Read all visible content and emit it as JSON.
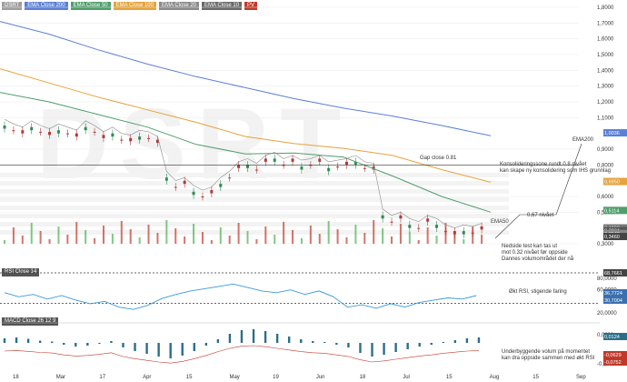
{
  "legend": [
    {
      "label": "DSRT",
      "color": "#9e9e9e"
    },
    {
      "label": "EMA Close 200",
      "color": "#5b7fd6"
    },
    {
      "label": "EMA Close 50",
      "color": "#4f9e6a"
    },
    {
      "label": "EMA Close 100",
      "color": "#e6a23c"
    },
    {
      "label": "EMA Close 20",
      "color": "#8a8a8a"
    },
    {
      "label": "EMA Close 10",
      "color": "#6a6a6a"
    },
    {
      "label": "PV",
      "color": "#c0392b"
    }
  ],
  "watermark": "DSRT",
  "rsi_label": "RSI Close 14",
  "macd_label": "MACD Close 26 12 9",
  "chart_data": [
    {
      "type": "candlestick",
      "ylim": [
        0.3,
        1.8
      ],
      "yticks": [
        "1,8000",
        "1,7000",
        "1,6000",
        "1,5000",
        "1,4000",
        "1,3000",
        "1,2000",
        "1,1000",
        "0,9000",
        "0,8000",
        "0,6000",
        "0,5000",
        "0,3000"
      ],
      "yticks_values": [
        1.8,
        1.7,
        1.6,
        1.5,
        1.4,
        1.3,
        1.2,
        1.1,
        0.9,
        0.8,
        0.6,
        0.5,
        0.3
      ],
      "x_ticks": [
        "18",
        "Mar",
        "17",
        "Apr",
        "15",
        "May",
        "19",
        "Jun",
        "18",
        "Jul",
        "15",
        "Aug",
        "15",
        "Sep"
      ],
      "price_badges": [
        {
          "label": "1,0036",
          "value": 1.0036,
          "color": "#5b7fd6"
        },
        {
          "label": "0,6950",
          "value": 0.695,
          "color": "#e6a23c"
        },
        {
          "label": "0,5114",
          "value": 0.5114,
          "color": "#4f9e6a"
        },
        {
          "label": "0,4008",
          "value": 0.4008,
          "color": "#777777"
        },
        {
          "label": "0,3834",
          "value": 0.3834,
          "color": "#555555"
        },
        {
          "label": "0,3648",
          "value": 0.3648,
          "color": "#888888"
        },
        {
          "label": "0,3460",
          "value": 0.346,
          "color": "#444444"
        }
      ],
      "annotations": [
        {
          "text": "Gap close 0.81",
          "target": "gap-close"
        },
        {
          "text": "Konsolideringssone rundt 0.8 nivået",
          "target": "consolidation"
        },
        {
          "text": "kan skape ny konsolidering som IHS grunnlag",
          "target": "consolidation"
        },
        {
          "text": "EMA200",
          "target": "ema200"
        },
        {
          "text": "0,67 nivået",
          "target": "level-067"
        },
        {
          "text": "EMA50",
          "target": "ema50"
        },
        {
          "text": "Nedside test kan tas ut",
          "target": "downside"
        },
        {
          "text": "mot 0.32 nivået før oppside",
          "target": "downside"
        },
        {
          "text": "Dannes volumområdet der nå",
          "target": "downside"
        }
      ],
      "series": [
        {
          "name": "EMA Close 200",
          "color": "#5b7fd6",
          "x": [
            0,
            0.1,
            0.2,
            0.3,
            0.4,
            0.5,
            0.6,
            0.7,
            0.8,
            0.9,
            1.0
          ],
          "values": [
            1.71,
            1.63,
            1.53,
            1.44,
            1.36,
            1.29,
            1.22,
            1.16,
            1.11,
            1.05,
            0.985
          ]
        },
        {
          "name": "EMA Close 100",
          "color": "#e6a23c",
          "x": [
            0,
            0.1,
            0.2,
            0.3,
            0.4,
            0.5,
            0.6,
            0.7,
            0.8,
            0.9,
            1.0
          ],
          "values": [
            1.41,
            1.32,
            1.23,
            1.15,
            1.07,
            0.98,
            0.935,
            0.905,
            0.86,
            0.77,
            0.69
          ]
        },
        {
          "name": "EMA Close 50",
          "color": "#4f9e6a",
          "x": [
            0,
            0.1,
            0.2,
            0.3,
            0.4,
            0.5,
            0.6,
            0.7,
            0.8,
            0.9,
            1.0
          ],
          "values": [
            1.26,
            1.2,
            1.12,
            1.04,
            0.93,
            0.87,
            0.875,
            0.85,
            0.73,
            0.6,
            0.5
          ]
        }
      ]
    },
    {
      "type": "line",
      "name": "RSI Close 14",
      "ylim": [
        20,
        80
      ],
      "yticks": [
        "80,0000",
        "60,0000",
        "20,0000"
      ],
      "yticks_values": [
        80,
        60,
        20
      ],
      "price_badges": [
        {
          "label": "68,7661",
          "value": 68.7661
        },
        {
          "label": "36,7724",
          "value": 36.7724
        },
        {
          "label": "30,7004",
          "value": 30.7004
        }
      ],
      "annotations": [
        {
          "text": "Økt RSI, stigende faring"
        }
      ],
      "values": [
        55,
        48,
        52,
        44,
        50,
        42,
        36,
        40,
        30,
        26,
        33,
        45,
        52,
        58,
        62,
        66,
        70,
        64,
        58,
        55,
        60,
        52,
        58,
        48,
        30,
        34,
        28,
        36,
        30,
        38,
        42,
        46,
        44,
        50
      ]
    },
    {
      "type": "bar",
      "name": "MACD Close 26 12 9",
      "yticks": [
        "0,0000",
        "-0,1000"
      ],
      "yticks_values": [
        0,
        -0.1
      ],
      "price_badges": [
        {
          "label": "0,0124",
          "value": 0.0124
        },
        {
          "label": "-0,0629",
          "value": -0.0629
        },
        {
          "label": "-0,0752",
          "value": -0.0752
        }
      ],
      "annotations": [
        {
          "text": "Underbyggende volum på momentet"
        },
        {
          "text": "kan dra oppside sammen med økt RSI"
        }
      ],
      "values": [
        0.01,
        0.012,
        0.009,
        0.005,
        0.003,
        -0.004,
        -0.008,
        -0.006,
        -0.002,
        0.004,
        -0.01,
        -0.018,
        -0.024,
        -0.03,
        -0.034,
        -0.028,
        -0.018,
        -0.006,
        0.008,
        0.02,
        0.028,
        0.03,
        0.026,
        0.02,
        0.014,
        0.008,
        0.004,
        0.002,
        -0.004,
        -0.01,
        -0.022,
        -0.03,
        -0.026,
        -0.02,
        -0.014,
        -0.008,
        -0.004,
        0.002,
        0.006,
        0.01,
        0.012
      ]
    }
  ]
}
